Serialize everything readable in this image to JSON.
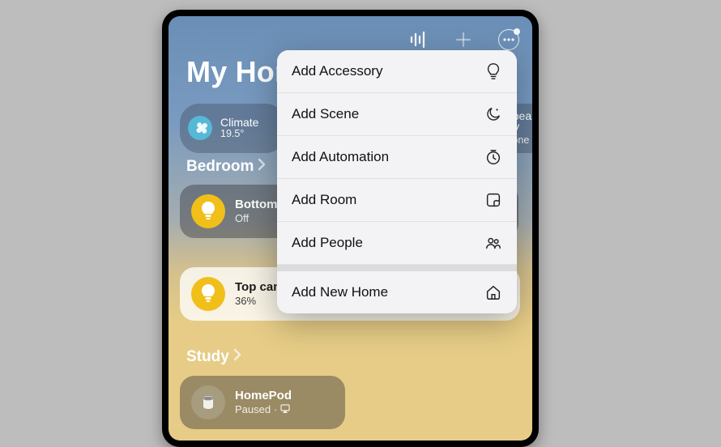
{
  "title": "My Home",
  "chips": {
    "climate": {
      "label": "Climate",
      "value": "19.5°"
    },
    "speakers": {
      "label": "Speakers & TV",
      "value": "None"
    }
  },
  "sections": {
    "bedroom": "Bedroom",
    "study": "Study"
  },
  "tiles": {
    "bottom": {
      "name": "Bottom candle",
      "state": "Off"
    },
    "top": {
      "name": "Top candle",
      "state": "36%"
    },
    "homepod": {
      "name": "HomePod",
      "state": "Paused"
    }
  },
  "menu": {
    "accessory": "Add Accessory",
    "scene": "Add Scene",
    "automation": "Add Automation",
    "room": "Add Room",
    "people": "Add People",
    "newhome": "Add New Home"
  }
}
